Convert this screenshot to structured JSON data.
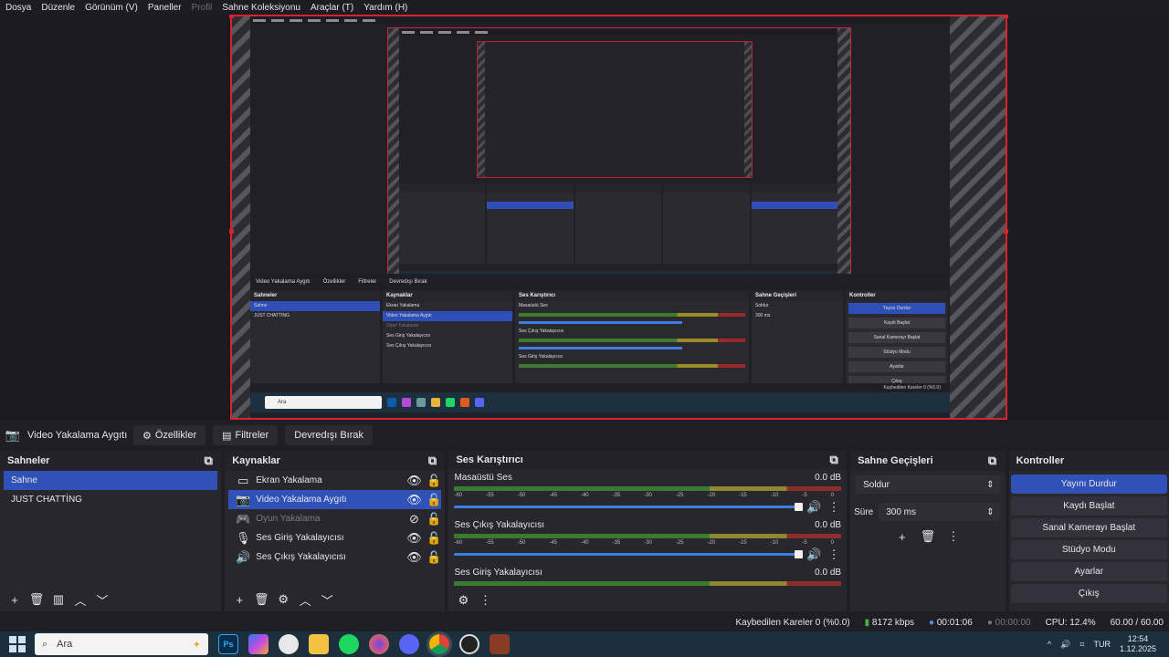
{
  "menu": [
    "Dosya",
    "Düzenle",
    "Görünüm (V)",
    "Paneller",
    "Profil",
    "Sahne Koleksiyonu",
    "Araçlar (T)",
    "Yardım (H)"
  ],
  "menu_disabled": "Profil",
  "source_toolbar": {
    "source_name": "Video Yakalama Aygıtı",
    "properties": "Özellikler",
    "filters": "Filtreler",
    "deactivate": "Devredışı Bırak"
  },
  "scenes": {
    "title": "Sahneler",
    "items": [
      "Sahne",
      "JUST CHATTİNG"
    ],
    "selected": "Sahne"
  },
  "sources": {
    "title": "Kaynaklar",
    "items": [
      {
        "label": "Ekran Yakalama",
        "icon": "monitor-icon"
      },
      {
        "label": "Video Yakalama Aygıtı",
        "icon": "camera-icon"
      },
      {
        "label": "Oyun Yakalama",
        "icon": "gamepad-icon"
      },
      {
        "label": "Ses Giriş Yakalayıcısı",
        "icon": "microphone-icon"
      },
      {
        "label": "Ses Çıkış Yakalayıcısı",
        "icon": "speaker-icon"
      }
    ],
    "selected": "Video Yakalama Aygıtı",
    "hidden": "Oyun Yakalama"
  },
  "mixer": {
    "title": "Ses Karıştırıcı",
    "channels": [
      {
        "name": "Masaüstü Ses",
        "db": "0.0 dB",
        "level": 0.92
      },
      {
        "name": "Ses Çıkış Yakalayıcısı",
        "db": "0.0 dB",
        "level": 0.92
      },
      {
        "name": "Ses Giriş Yakalayıcısı",
        "db": "0.0 dB",
        "level": 0.92
      }
    ],
    "ticks": [
      "-60",
      "-55",
      "-50",
      "-45",
      "-40",
      "-35",
      "-30",
      "-25",
      "-20",
      "-15",
      "-10",
      "-5",
      "0"
    ]
  },
  "transitions": {
    "title": "Sahne Geçişleri",
    "transition": "Soldur",
    "duration_label": "Süre",
    "duration": "300 ms"
  },
  "controls": {
    "title": "Kontroller",
    "stop_stream": "Yayını Durdur",
    "start_recording": "Kaydı Başlat",
    "virtual_camera": "Sanal Kamerayı Başlat",
    "studio_mode": "Stüdyo Modu",
    "settings": "Ayarlar",
    "exit": "Çıkış"
  },
  "status": {
    "dropped": "Kaybedilen Kareler 0 (%0.0)",
    "bitrate": "8172 kbps",
    "stream_time": "00:01:06",
    "record_time": "00:00:00",
    "cpu": "CPU: 12.4%",
    "fps": "60.00 / 60.00"
  },
  "taskbar": {
    "search": "Ara",
    "lang": "TUR",
    "time": "12:54",
    "date": "1.12.2025",
    "apps": [
      "ps-icon",
      "copilot-icon",
      "chatgpt-icon",
      "folder-icon",
      "spotify-icon",
      "firefox-icon",
      "discord-icon",
      "chrome-icon",
      "obs-icon",
      "game-icon"
    ]
  },
  "inner": {
    "scenes": "Sahneler",
    "sources": "Kaynaklar",
    "mixer": "Ses Karıştırıcı",
    "transitions": "Sahne Geçişleri",
    "controls": "Kontroller"
  },
  "colors": {
    "accent": "#2f51b8",
    "record": "#d5232f",
    "meter_green": "#3b7a31"
  }
}
